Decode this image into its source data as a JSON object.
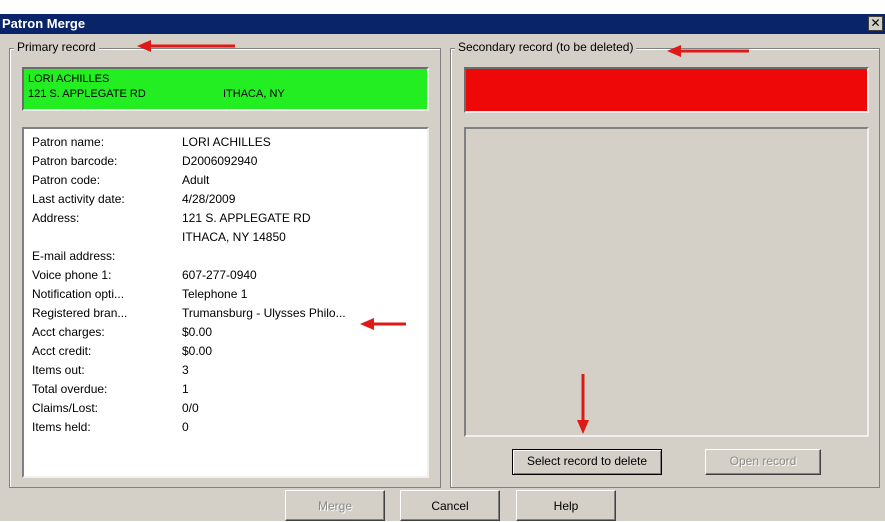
{
  "window": {
    "title": "Patron Merge",
    "close_glyph": "✕"
  },
  "primary": {
    "legend": "Primary record",
    "banner_color": "#22ee22",
    "banner": {
      "name": "LORI ACHILLES",
      "street": "121 S. APPLEGATE RD",
      "city": "ITHACA, NY"
    },
    "fields": [
      {
        "label": "Patron name:",
        "value": "LORI ACHILLES"
      },
      {
        "label": "Patron barcode:",
        "value": "D2006092940"
      },
      {
        "label": "Patron code:",
        "value": "Adult"
      },
      {
        "label": "Last activity date:",
        "value": "4/28/2009"
      },
      {
        "label": "Address:",
        "value": "121 S. APPLEGATE RD"
      },
      {
        "label": "",
        "value": "ITHACA, NY 14850"
      },
      {
        "label": "E-mail address:",
        "value": ""
      },
      {
        "label": "Voice phone 1:",
        "value": "607-277-0940"
      },
      {
        "label": "Notification opti...",
        "value": "Telephone 1"
      },
      {
        "label": "Registered bran...",
        "value": "Trumansburg - Ulysses Philo..."
      },
      {
        "label": "Acct charges:",
        "value": "$0.00"
      },
      {
        "label": "Acct credit:",
        "value": "$0.00"
      },
      {
        "label": "Items out:",
        "value": "3"
      },
      {
        "label": "Total overdue:",
        "value": "1"
      },
      {
        "label": "Claims/Lost:",
        "value": "0/0"
      },
      {
        "label": "Items held:",
        "value": "0"
      }
    ]
  },
  "secondary": {
    "legend": "Secondary record (to be deleted)",
    "banner_color": "#ee0808",
    "select_button": "Select record to delete",
    "open_button": "Open record"
  },
  "footer": {
    "merge_button": "Merge",
    "cancel_button": "Cancel",
    "help_button": "Help"
  },
  "colors": {
    "annotation_arrow": "#e01818",
    "titlebar": "#0a246a"
  }
}
